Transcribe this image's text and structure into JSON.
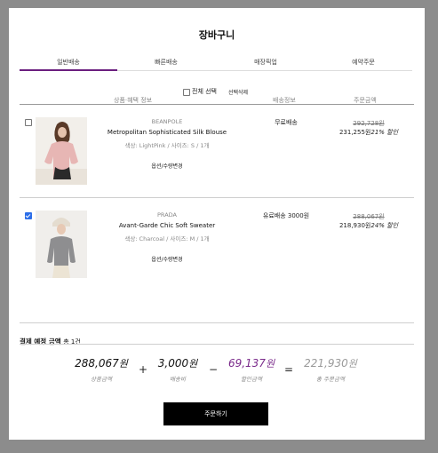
{
  "page_title": "장바구니",
  "tabs": [
    {
      "label": "일반배송",
      "active": true
    },
    {
      "label": "빠른배송",
      "active": false
    },
    {
      "label": "매장픽업",
      "active": false
    },
    {
      "label": "예약주문",
      "active": false
    }
  ],
  "table": {
    "col_product": "상품·혜택 정보",
    "select_all": "전체 선택",
    "delete_selected": "선택삭제",
    "col_shipping": "배송정보",
    "col_amount": "주문금액"
  },
  "items": [
    {
      "checked": false,
      "brand": "BEANPOLE",
      "name": "Metropolitan Sophisticated Silk Blouse",
      "options": "색상: LightPink / 사이즈: S / 1개",
      "option_button": "옵션/수량변경",
      "shipping": "무료배송",
      "original_price": "292,728원",
      "sale_price": "231,255원",
      "discount": "21% 할인"
    },
    {
      "checked": true,
      "brand": "PRADA",
      "name": "Avant-Garde Chic Soft Sweater",
      "options": "색상: Charcoal / 사이즈: M / 1개",
      "option_button": "옵션/수량변경",
      "shipping": "유료배송 3000원",
      "original_price": "288,067원",
      "sale_price": "218,930원",
      "discount": "24% 할인"
    }
  ],
  "summary": {
    "title": "결제 예정 금액",
    "count": "총 1건",
    "product_amount": "288,067",
    "product_label": "상품금액",
    "shipping_amount": "3,000",
    "shipping_label": "배송비",
    "discount_amount": "69,137",
    "discount_label": "할인금액",
    "total_amount": "221,930",
    "total_label": "총 주문금액",
    "won": "원",
    "op_plus": "+",
    "op_minus": "−",
    "op_equals": "=",
    "discount_color": "#7a2a8a",
    "total_color": "#9a9a9a"
  },
  "order_button": "주문하기",
  "accent_color": "#6b1f7f"
}
